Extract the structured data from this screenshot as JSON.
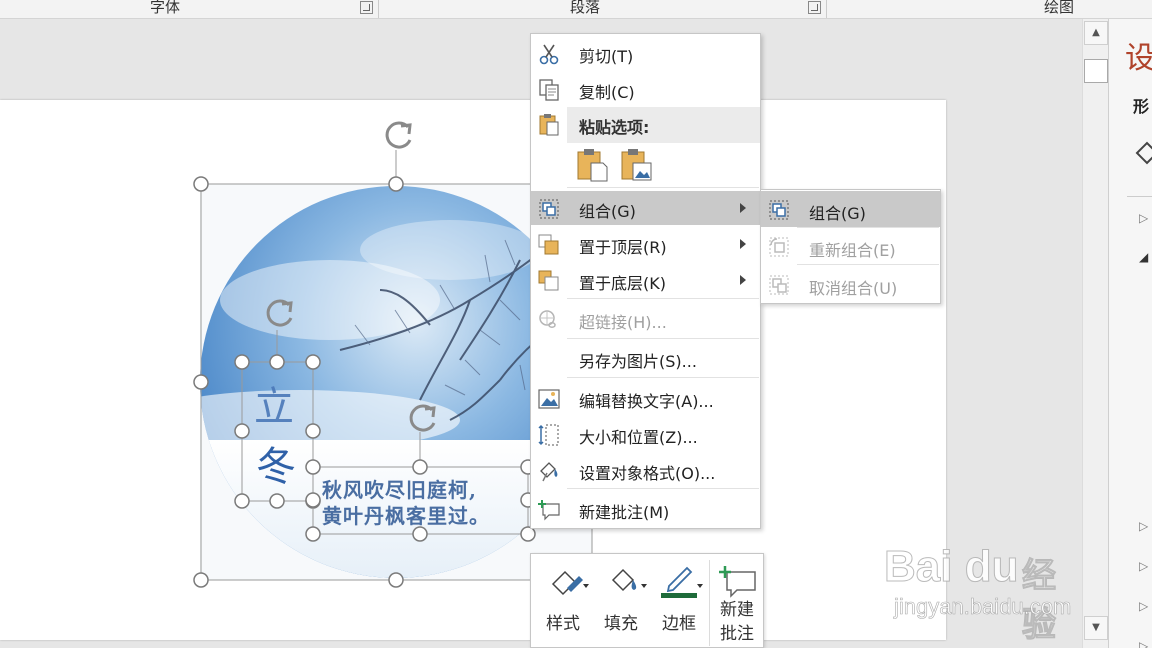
{
  "ribbon": {
    "groups": [
      "字体",
      "段落",
      "绘图"
    ]
  },
  "format_pane": {
    "title": "设",
    "tab": "形"
  },
  "picture": {
    "poem_line_1": "秋风吹尽旧庭柯,",
    "poem_line_2": "黄叶丹枫客里过。",
    "title_char_1": "立",
    "title_char_2": "冬"
  },
  "context_menu": {
    "items": [
      {
        "label": "剪切(T)",
        "icon": "scissors-icon",
        "enabled": true
      },
      {
        "label": "复制(C)",
        "icon": "copy-icon",
        "enabled": true
      },
      {
        "label": "粘贴选项:",
        "icon": "paste-icon",
        "enabled": true
      },
      {
        "label": "组合(G)",
        "icon": "group-icon",
        "enabled": true,
        "submenu": true,
        "highlighted": true
      },
      {
        "label": "置于顶层(R)",
        "icon": "bring-to-front-icon",
        "enabled": true,
        "submenu": true
      },
      {
        "label": "置于底层(K)",
        "icon": "send-to-back-icon",
        "enabled": true,
        "submenu": true
      },
      {
        "label": "超链接(H)...",
        "icon": "hyperlink-icon",
        "enabled": false
      },
      {
        "label": "另存为图片(S)...",
        "icon": "",
        "enabled": true
      },
      {
        "label": "编辑替换文字(A)...",
        "icon": "alt-text-icon",
        "enabled": true
      },
      {
        "label": "大小和位置(Z)...",
        "icon": "size-position-icon",
        "enabled": true
      },
      {
        "label": "设置对象格式(O)...",
        "icon": "format-object-icon",
        "enabled": true
      },
      {
        "label": "新建批注(M)",
        "icon": "comment-icon",
        "enabled": true
      }
    ],
    "paste_icons": [
      "paste-keep-format-icon",
      "paste-as-picture-icon"
    ]
  },
  "submenu": {
    "items": [
      {
        "label": "组合(G)",
        "icon": "group-icon",
        "enabled": true,
        "highlighted": true
      },
      {
        "label": "重新组合(E)",
        "icon": "regroup-icon",
        "enabled": false
      },
      {
        "label": "取消组合(U)",
        "icon": "ungroup-icon",
        "enabled": false
      }
    ]
  },
  "mini_toolbar": {
    "buttons": [
      {
        "label": "样式",
        "icon": "style-icon"
      },
      {
        "label": "填充",
        "icon": "fill-bucket-icon"
      },
      {
        "label": "边框",
        "icon": "outline-pen-icon"
      },
      {
        "label": "新建\n批注",
        "icon": "new-comment-icon"
      }
    ],
    "outline_color": "#1e6b3a"
  },
  "watermark": {
    "brand": "Bai du",
    "brand_cn": "经验",
    "url": "jingyan.baidu.com"
  },
  "colors": {
    "menu_highlight": "#c9c9c9",
    "pane_title": "#b0432b",
    "poem_text": "#4a6ea2"
  }
}
